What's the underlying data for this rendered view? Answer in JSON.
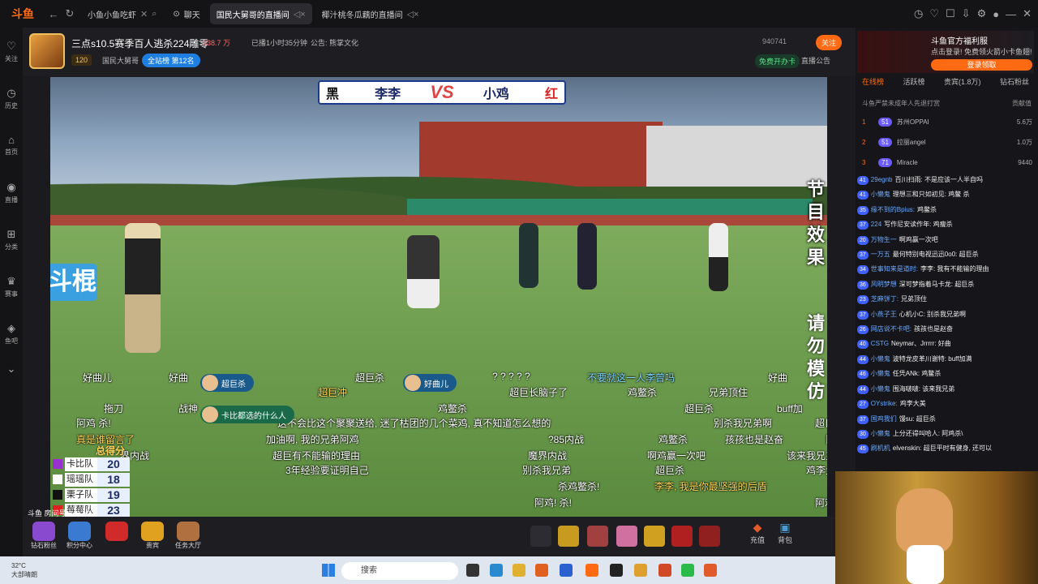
{
  "browser": {
    "logo": "斗鱼",
    "tabs": [
      {
        "label": "小鱼小鱼吃虾"
      },
      {
        "label": "聊天"
      },
      {
        "label": "国民大舅哥的直播间"
      },
      {
        "label": "椰汁桃冬瓜藕的直播间"
      }
    ]
  },
  "sidebar": {
    "items": [
      "关注",
      "历史",
      "首页",
      "直播",
      "分类",
      "赛事",
      "鱼吧"
    ]
  },
  "room": {
    "title": "三点s10.5赛季百人逃杀224雕零",
    "heat": "338.7 万",
    "live_time": "已播1小时35分钟",
    "notice": "公告: 熊掌文化",
    "level": "120",
    "host": "国民大舅哥",
    "rank": "全站榜  第12名",
    "room_no": "940741",
    "follow": "关注",
    "free_card": "免费开办卡",
    "live_notice": "直播公告"
  },
  "video": {
    "vs_left_team": "黑",
    "vs_left_name": "李李",
    "vs_text": "VS",
    "vs_right_name": "小鸡",
    "vs_right_team": "红",
    "side_text_1": "节目效果",
    "side_text_2": "请勿模仿",
    "left_logo": "斗棍",
    "watermark": "斗鱼 房间号:940741"
  },
  "danmaku": [
    {
      "t": "好曲儿",
      "c": "w"
    },
    {
      "t": "好曲",
      "c": "w"
    },
    {
      "t": "超巨杀",
      "c": "w"
    },
    {
      "t": "? ? ? ? ?",
      "c": "w"
    },
    {
      "t": "不要就这一人李曾吗",
      "c": "b"
    },
    {
      "t": "好曲",
      "c": "w"
    },
    {
      "t": "超巨",
      "c": "w"
    },
    {
      "t": "超巨冲",
      "c": "y"
    },
    {
      "t": "超巨长脑子了",
      "c": "w"
    },
    {
      "t": "鸡鳖杀",
      "c": "w"
    },
    {
      "t": "兄弟顶住",
      "c": "w"
    },
    {
      "t": "拖刀",
      "c": "w"
    },
    {
      "t": "战神",
      "c": "w"
    },
    {
      "t": "鸡鳖杀",
      "c": "w"
    },
    {
      "t": "超巨杀",
      "c": "w"
    },
    {
      "t": "buff加",
      "c": "w"
    },
    {
      "t": "鸡鳖杀",
      "c": "w"
    },
    {
      "t": "阿鸡 杀!",
      "c": "w"
    },
    {
      "t": "这不会比这个聚聚送给, 迷了枯团的几个菜鸡, 真不知道怎么想的",
      "c": "w"
    },
    {
      "t": "别杀我兄弟啊",
      "c": "w"
    },
    {
      "t": "超巨杀",
      "c": "w"
    },
    {
      "t": "真是谁留言了",
      "c": "y"
    },
    {
      "t": "加油啊, 我的兄弟阿鸡",
      "c": "w"
    },
    {
      "t": "?85内战",
      "c": "w"
    },
    {
      "t": "鸡鳖杀",
      "c": "w"
    },
    {
      "t": "孩孩也是赵奋",
      "c": "w"
    },
    {
      "t": "界内战",
      "c": "w"
    },
    {
      "t": "超巨有不能输的理由",
      "c": "w"
    },
    {
      "t": "魔界内战",
      "c": "w"
    },
    {
      "t": "啊鸡赢一次吧",
      "c": "w"
    },
    {
      "t": "该来我兄弟",
      "c": "w"
    },
    {
      "t": "3年经验要证明自己",
      "c": "w"
    },
    {
      "t": "别杀我兄弟",
      "c": "w"
    },
    {
      "t": "超巨杀",
      "c": "w"
    },
    {
      "t": "鸡李大美",
      "c": "w"
    },
    {
      "t": "杀鸡鳖杀!",
      "c": "w"
    },
    {
      "t": "李李, 我是你最坚强的后盾",
      "c": "y"
    },
    {
      "t": "阿鸡! 杀!",
      "c": "w"
    },
    {
      "t": "战",
      "c": "w"
    },
    {
      "t": "阿",
      "c": "b"
    },
    {
      "t": "阿鸡",
      "c": "w"
    }
  ],
  "danmaku_pills": [
    {
      "t": "超巨杀"
    },
    {
      "t": "好曲儿"
    },
    {
      "t": "卡比都选的什么人"
    }
  ],
  "scoreboard": {
    "title": "总得分",
    "rows": [
      {
        "name": "卡比队",
        "score": "20",
        "color": "#9b30d0"
      },
      {
        "name": "瑶瑶队",
        "score": "18",
        "color": "#ffffff"
      },
      {
        "name": "栗子队",
        "score": "19",
        "color": "#111111"
      },
      {
        "name": "莓莓队",
        "score": "23",
        "color": "#e02020"
      }
    ]
  },
  "bottom": {
    "items": [
      "钻石粉丝",
      "积分中心",
      "",
      "贵宾",
      "任务大厅"
    ],
    "recharge": "充值",
    "bag": "背包"
  },
  "right": {
    "ad_title": "斗鱼官方福利服",
    "ad_sub": "点击登录! 免费领火箭小卡鱼翅!",
    "ad_btn": "登录领取",
    "tabs": [
      "在线榜",
      "活跃榜",
      "贵宾(1.8万)",
      "钻石粉丝"
    ],
    "note": "斗鱼严禁未成年人先退打赏",
    "value_label": "贡献值",
    "ranks": [
      {
        "n": "1",
        "lv": "51",
        "name": "苏州OPPAI",
        "v": "5.6万"
      },
      {
        "n": "2",
        "lv": "51",
        "name": "拉丽angel",
        "v": "1.0万"
      },
      {
        "n": "3",
        "lv": "71",
        "name": "Miracle",
        "v": "9440"
      }
    ],
    "chat": [
      {
        "lv": "41",
        "u": "29egnb",
        "m": "百川扫雨: 不是应该一人半自吗"
      },
      {
        "lv": "41",
        "u": "小懒鬼",
        "m": "理想三和只如初见: 鸡鳖 杀"
      },
      {
        "lv": "35",
        "u": "缘不到的Bpius:",
        "m": "鸡鳖杀"
      },
      {
        "lv": "37",
        "u": "224",
        "m": "写作尼安读作年: 鸡瘦杀"
      },
      {
        "lv": "20",
        "u": "万物生一",
        "m": "啊鸡赢一次吧"
      },
      {
        "lv": "37",
        "u": "一万五",
        "m": "最何特别电视迅迅0o0: 超巨杀"
      },
      {
        "lv": "34",
        "u": "世事知来是道时:",
        "m": "李李: 我有不能输的理由"
      },
      {
        "lv": "36",
        "u": "风明梦想",
        "m": "深可梦指着马卡龙: 超巨杀"
      },
      {
        "lv": "23",
        "u": "芝麻饼丁:",
        "m": "兄弟顶住"
      },
      {
        "lv": "37",
        "u": "小燕子王",
        "m": "心机小C: 别杀我兄弟啊"
      },
      {
        "lv": "26",
        "u": "网店说不卡吧:",
        "m": "孩孩也是赵奋"
      },
      {
        "lv": "40",
        "u": "CSTG",
        "m": "Neymar、Jrrrrr: 好曲"
      },
      {
        "lv": "44",
        "u": "小懒鬼",
        "m": "波特龙皮革川谢特: buff加满"
      },
      {
        "lv": "46",
        "u": "小懒鬼",
        "m": "任凭ANk: 鸡鳖杀"
      },
      {
        "lv": "44",
        "u": "小懒鬼",
        "m": "围海啵啵: 该来我兄弟"
      },
      {
        "lv": "27",
        "u": "OYstrike:",
        "m": "鸡李大美"
      },
      {
        "lv": "37",
        "u": "国鸡我们",
        "m": "馒su: 超巨杀"
      },
      {
        "lv": "30",
        "u": "小懒鬼",
        "m": "上分还得叫哈人: 阿鸡杀\\"
      },
      {
        "lv": "45",
        "u": "刷机机",
        "m": "elvenskin: 超巨平时有健身, 还可以"
      }
    ]
  },
  "taskbar": {
    "temp": "32°C",
    "weather": "大部晴朗",
    "search": "搜索"
  }
}
